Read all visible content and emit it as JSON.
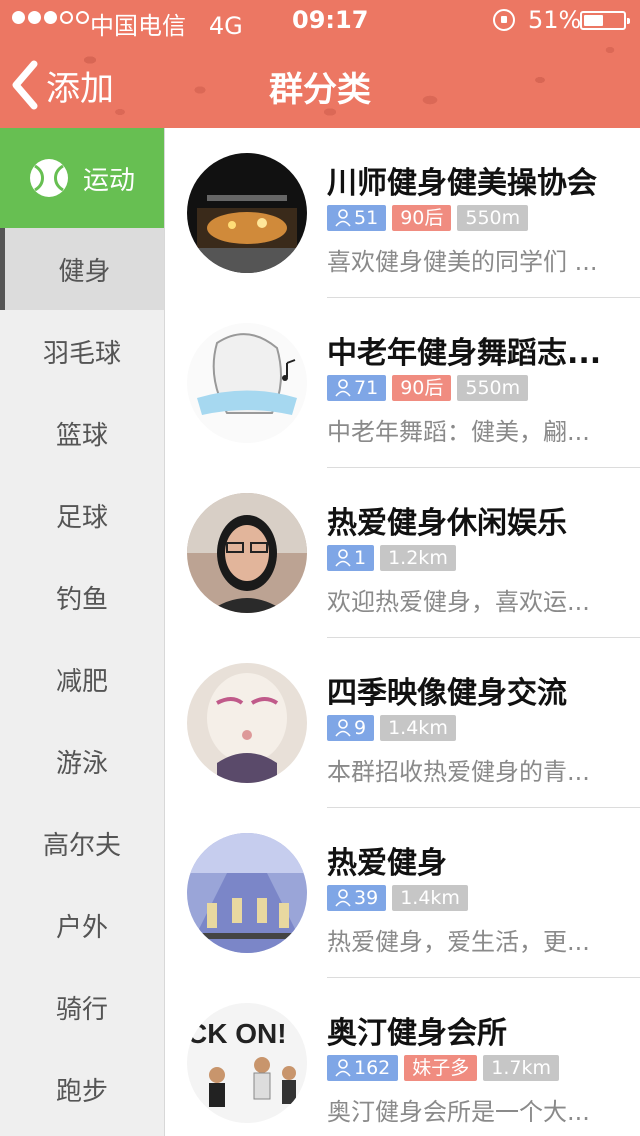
{
  "status_bar": {
    "carrier": "中国电信",
    "network": "4G",
    "time": "09:17",
    "battery": "51%",
    "battery_level": 0.51
  },
  "nav": {
    "back_label": "添加",
    "title": "群分类"
  },
  "sidebar": {
    "category": "运动",
    "items": [
      {
        "label": "健身"
      },
      {
        "label": "羽毛球"
      },
      {
        "label": "篮球"
      },
      {
        "label": "足球"
      },
      {
        "label": "钓鱼"
      },
      {
        "label": "减肥"
      },
      {
        "label": "游泳"
      },
      {
        "label": "高尔夫"
      },
      {
        "label": "户外"
      },
      {
        "label": "骑行"
      },
      {
        "label": "跑步"
      }
    ]
  },
  "groups": [
    {
      "title": "川师健身健美操协会",
      "members": "51",
      "tag": "90后",
      "distance": "550m",
      "desc": "喜欢健身健美的同学们 ..."
    },
    {
      "title": "中老年健身舞蹈志...",
      "members": "71",
      "tag": "90后",
      "distance": "550m",
      "desc": "中老年舞蹈：健美，翩..."
    },
    {
      "title": "热爱健身休闲娱乐",
      "members": "1",
      "tag": "",
      "distance": "1.2km",
      "desc": "欢迎热爱健身，喜欢运..."
    },
    {
      "title": "四季映像健身交流",
      "members": "9",
      "tag": "",
      "distance": "1.4km",
      "desc": "本群招收热爱健身的青..."
    },
    {
      "title": "热爱健身",
      "members": "39",
      "tag": "",
      "distance": "1.4km",
      "desc": "热爱健身，爱生活，更..."
    },
    {
      "title": "奥汀健身会所",
      "members": "162",
      "tag": "妹子多",
      "distance": "1.7km",
      "desc": "奥汀健身会所是一个大...",
      "avatar_text": "CK ON!"
    }
  ],
  "colors": {
    "header": "#ec7763",
    "category": "#67bf52",
    "members_tag": "#7fa6e6",
    "pink_tag": "#f08c80",
    "grey_tag": "#c6c6c6"
  }
}
